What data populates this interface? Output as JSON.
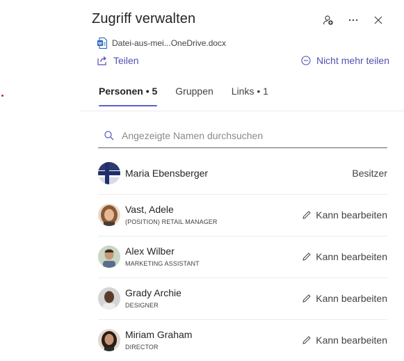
{
  "panel": {
    "title": "Zugriff verwalten",
    "file_name": "Datei-aus-mei...OneDrive.docx",
    "share_label": "Teilen",
    "stop_share_label": "Nicht mehr teilen"
  },
  "header_icons": [
    "add-people-icon",
    "more-icon",
    "close-icon"
  ],
  "tabs": [
    {
      "label": "Personen • 5",
      "active": true
    },
    {
      "label": "Gruppen",
      "active": false
    },
    {
      "label": "Links • 1",
      "active": false
    }
  ],
  "search": {
    "placeholder": "Angezeigte Namen durchsuchen"
  },
  "people": [
    {
      "name": "Maria Ebensberger",
      "role": "",
      "permission": "Besitzer"
    },
    {
      "name": "Vast, Adele",
      "role": "(POSITION) RETAIL MANAGER",
      "permission": "Kann bearbeiten"
    },
    {
      "name": "Alex Wilber",
      "role": "MARKETING ASSISTANT",
      "permission": "Kann bearbeiten"
    },
    {
      "name": "Grady Archie",
      "role": "DESIGNER",
      "permission": "Kann bearbeiten"
    },
    {
      "name": "Miriam Graham",
      "role": "DIRECTOR",
      "permission": "Kann bearbeiten"
    }
  ],
  "colors": {
    "accent": "#5b5fc7",
    "link": "#4f52b2",
    "word_blue": "#185abd"
  }
}
